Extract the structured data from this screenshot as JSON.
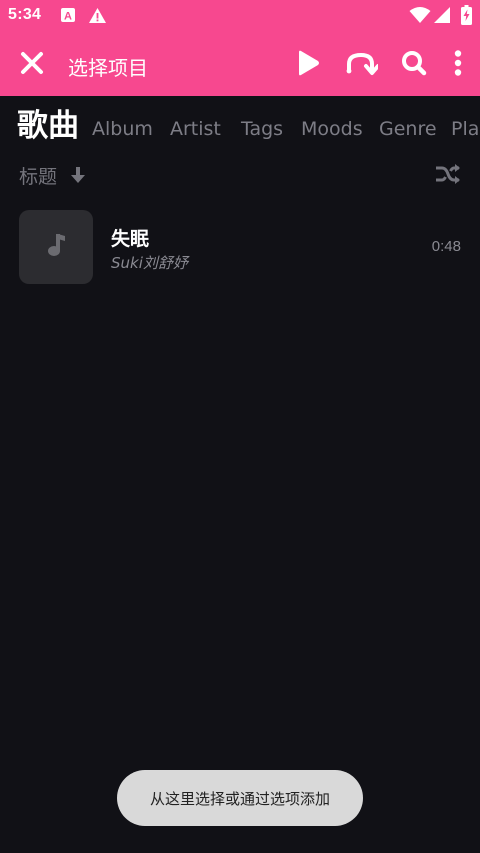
{
  "status_bar": {
    "time": "5:34",
    "icons": [
      "text-a-icon",
      "warning-icon",
      "wifi-icon",
      "signal-icon",
      "battery-charging-icon"
    ]
  },
  "action_bar": {
    "title": "选择项目",
    "icons": [
      "close-icon",
      "play-icon",
      "repeat-icon",
      "search-icon",
      "more-vert-icon"
    ]
  },
  "tabs": [
    {
      "label": "歌曲",
      "active": true
    },
    {
      "label": "Album",
      "active": false
    },
    {
      "label": "Artist",
      "active": false
    },
    {
      "label": "Tags",
      "active": false
    },
    {
      "label": "Moods",
      "active": false
    },
    {
      "label": "Genre",
      "active": false
    },
    {
      "label": "Pla",
      "active": false
    }
  ],
  "sort": {
    "label": "标题",
    "direction_icon": "arrow-down-icon",
    "shuffle_icon": "shuffle-icon"
  },
  "songs": [
    {
      "title": "失眠",
      "artist": "Suki刘舒妤",
      "duration": "0:48",
      "cover_icon": "music-note-icon"
    }
  ],
  "toast": {
    "text": "从这里选择或通过选项添加"
  },
  "colors": {
    "accent": "#f7488f",
    "background": "#111116",
    "cover": "#2c2c30",
    "muted_text": "#7d7d86",
    "toast_bg": "#d9d9d9"
  }
}
